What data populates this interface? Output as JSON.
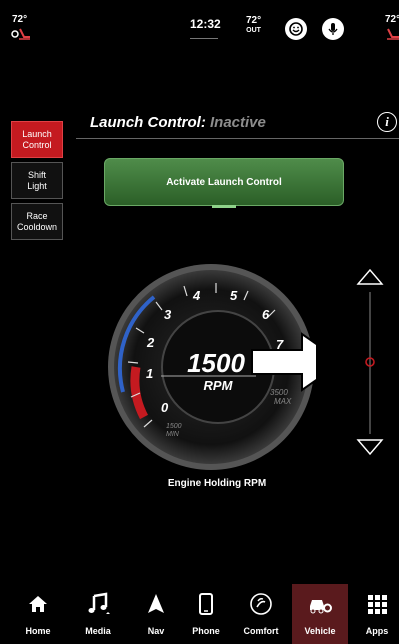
{
  "status_bar": {
    "left_temp": "72°",
    "right_temp": "72°",
    "clock": "12:32",
    "outside_temp": "72°",
    "outside_label": "OUT"
  },
  "header": {
    "title": "Launch Control:",
    "status": "Inactive",
    "info_icon": "info-icon"
  },
  "side_tabs": [
    {
      "label": "Launch\nControl",
      "active": true
    },
    {
      "label": "Shift\nLight",
      "active": false
    },
    {
      "label": "Race\nCooldown",
      "active": false
    }
  ],
  "activate_button": {
    "label": "Activate Launch Control"
  },
  "gauge": {
    "rpm_value": "1500",
    "rpm_unit": "RPM",
    "ticks": [
      "0",
      "1",
      "2",
      "3",
      "4",
      "5",
      "6",
      "7"
    ],
    "min_label_value": "1500",
    "min_label": "MIN",
    "max_label_value": "3500",
    "max_label": "MAX",
    "caption": "Engine Holding RPM"
  },
  "slider": {
    "up_icon": "triangle-up-icon",
    "down_icon": "triangle-down-icon"
  },
  "bottom_nav": [
    {
      "label": "Home",
      "icon": "home-icon",
      "active": false
    },
    {
      "label": "Media",
      "icon": "music-note-icon",
      "active": false
    },
    {
      "label": "Nav",
      "icon": "navigation-arrow-icon",
      "active": false
    },
    {
      "label": "Phone",
      "icon": "phone-icon",
      "active": false
    },
    {
      "label": "Comfort",
      "icon": "comfort-icon",
      "active": false
    },
    {
      "label": "Vehicle",
      "icon": "vehicle-icon",
      "active": true
    },
    {
      "label": "Apps",
      "icon": "apps-grid-icon",
      "active": false
    }
  ],
  "colors": {
    "accent_red": "#c41a20",
    "activate_green": "#3f7a3a",
    "gauge_blue": "#2f62c8"
  }
}
